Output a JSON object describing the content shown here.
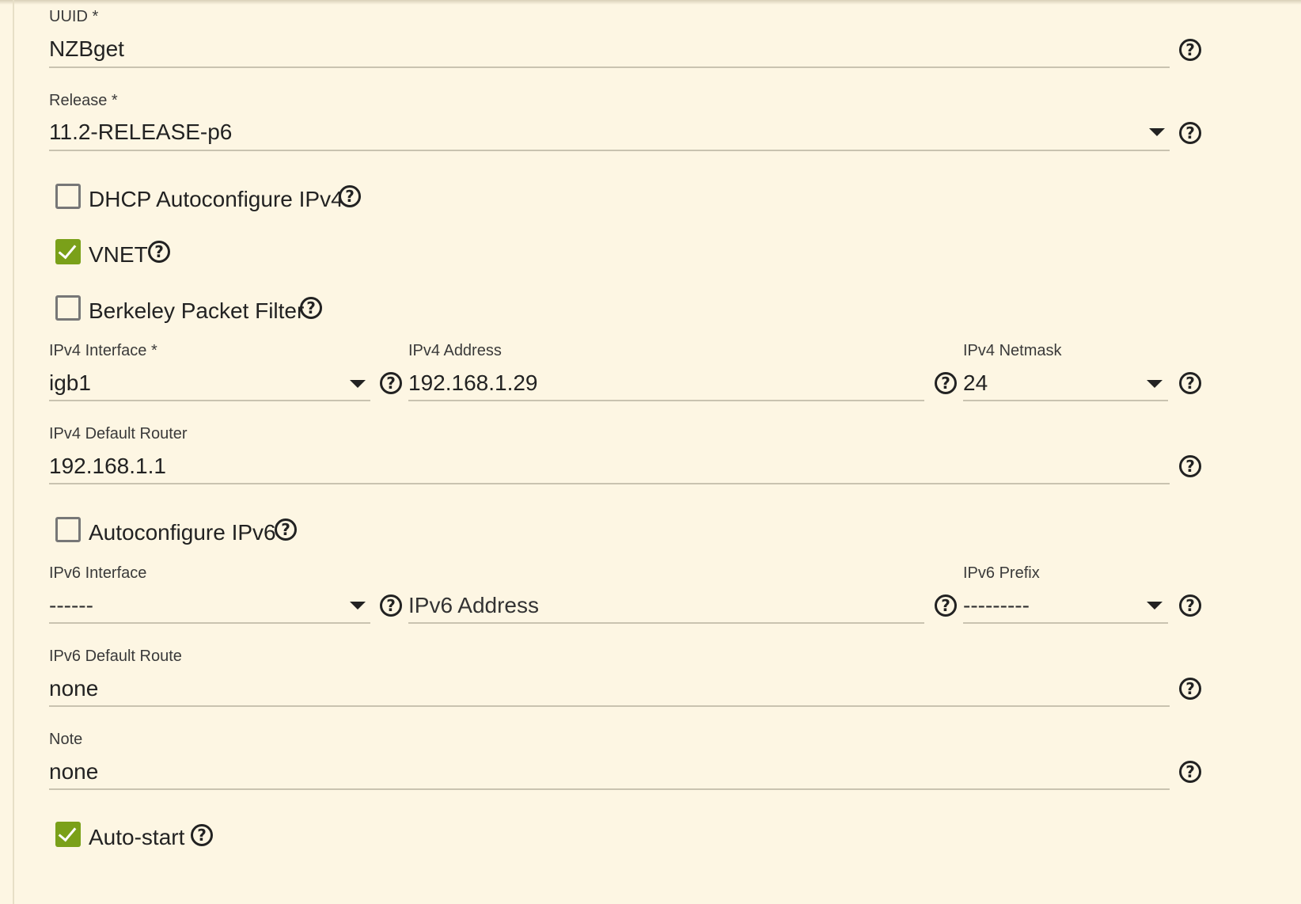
{
  "form": {
    "uuid": {
      "label": "UUID *",
      "value": "NZBget"
    },
    "release": {
      "label": "Release *",
      "value": "11.2-RELEASE-p6"
    },
    "dhcp": {
      "label": "DHCP Autoconfigure IPv4",
      "checked": false
    },
    "vnet": {
      "label": "VNET",
      "checked": true
    },
    "bpf": {
      "label": "Berkeley Packet Filter",
      "checked": false
    },
    "ipv4_interface": {
      "label": "IPv4 Interface *",
      "value": "igb1"
    },
    "ipv4_address": {
      "label": "IPv4 Address",
      "value": "192.168.1.29"
    },
    "ipv4_netmask": {
      "label": "IPv4 Netmask",
      "value": "24"
    },
    "ipv4_router": {
      "label": "IPv4 Default Router",
      "value": "192.168.1.1"
    },
    "autoconf_ipv6": {
      "label": "Autoconfigure IPv6",
      "checked": false
    },
    "ipv6_interface": {
      "label": "IPv6 Interface",
      "value": "------"
    },
    "ipv6_address": {
      "placeholder": "IPv6 Address"
    },
    "ipv6_prefix": {
      "label": "IPv6 Prefix",
      "value": "---------"
    },
    "ipv6_route": {
      "label": "IPv6 Default Route",
      "value": "none"
    },
    "note": {
      "label": "Note",
      "value": "none"
    },
    "autostart": {
      "label": "Auto-start",
      "checked": true
    }
  },
  "icons": {
    "help": "?",
    "dropdown": "chevron-down-icon"
  },
  "colors": {
    "background": "#fdf6e3",
    "checkbox_checked": "#7aa019",
    "underline": "#c9c3b0"
  }
}
